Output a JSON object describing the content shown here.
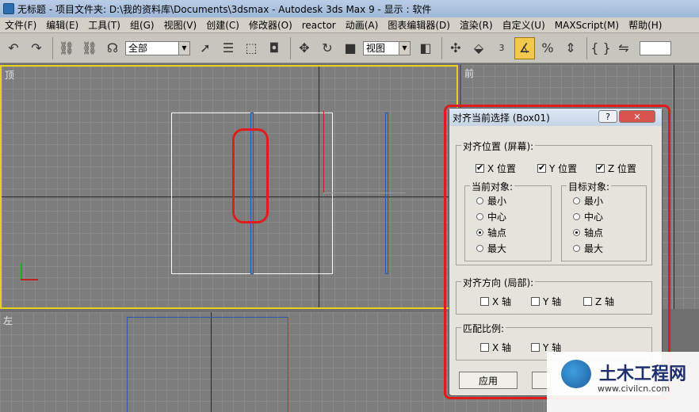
{
  "window": {
    "title": "无标题    - 项目文件夹: D:\\我的资料库\\Documents\\3dsmax     - Autodesk 3ds Max 9     - 显示 : 软件"
  },
  "menu": [
    "文件(F)",
    "编辑(E)",
    "工具(T)",
    "组(G)",
    "视图(V)",
    "创建(C)",
    "修改器(O)",
    "reactor",
    "动画(A)",
    "图表编辑器(D)",
    "渲染(R)",
    "自定义(U)",
    "MAXScript(M)",
    "帮助(H)"
  ],
  "toolbar": {
    "selection_filter": "全部",
    "ref_coord": "视图",
    "icons": [
      "undo-icon",
      "redo-icon",
      "link-icon",
      "unlink-icon",
      "bind-spacewarp-icon",
      "select-icon",
      "select-by-name-icon",
      "rect-region-icon",
      "window-crossing-icon",
      "move-icon",
      "rotate-icon",
      "scale-icon",
      "pivot-icon",
      "snap-3d-icon",
      "angle-snap-icon",
      "percent-snap-icon",
      "spinner-snap-icon",
      "named-selection-icon",
      "mirror-icon"
    ],
    "snap_3d_label": "3",
    "percent_label": "%"
  },
  "viewports": {
    "top": "顶",
    "front": "前",
    "left": "左"
  },
  "dialog": {
    "title": "对齐当前选择 (Box01)",
    "help_label": "?",
    "close_label": "✕",
    "align_position": {
      "label": "对齐位置 (屏幕):",
      "x": {
        "label": "X 位置",
        "checked": true
      },
      "y": {
        "label": "Y 位置",
        "checked": true
      },
      "z": {
        "label": "Z 位置",
        "checked": true
      }
    },
    "current_object": {
      "label": "当前对象:",
      "options": [
        "最小",
        "中心",
        "轴点",
        "最大"
      ],
      "selected": "轴点"
    },
    "target_object": {
      "label": "目标对象:",
      "options": [
        "最小",
        "中心",
        "轴点",
        "最大"
      ],
      "selected": "轴点"
    },
    "align_orientation": {
      "label": "对齐方向 (局部):",
      "x": "X 轴",
      "y": "Y 轴",
      "z": "Z 轴"
    },
    "match_scale": {
      "label": "匹配比例:",
      "x": "X 轴",
      "y": "Y 轴"
    },
    "apply_label": "应用"
  },
  "watermark": {
    "name": "土木工程网",
    "url": "www.civilcn.com"
  },
  "colors": {
    "highlight_red": "#e01b1b",
    "active_viewport": "#e6d21e",
    "object_blue": "#2a5aa8"
  }
}
